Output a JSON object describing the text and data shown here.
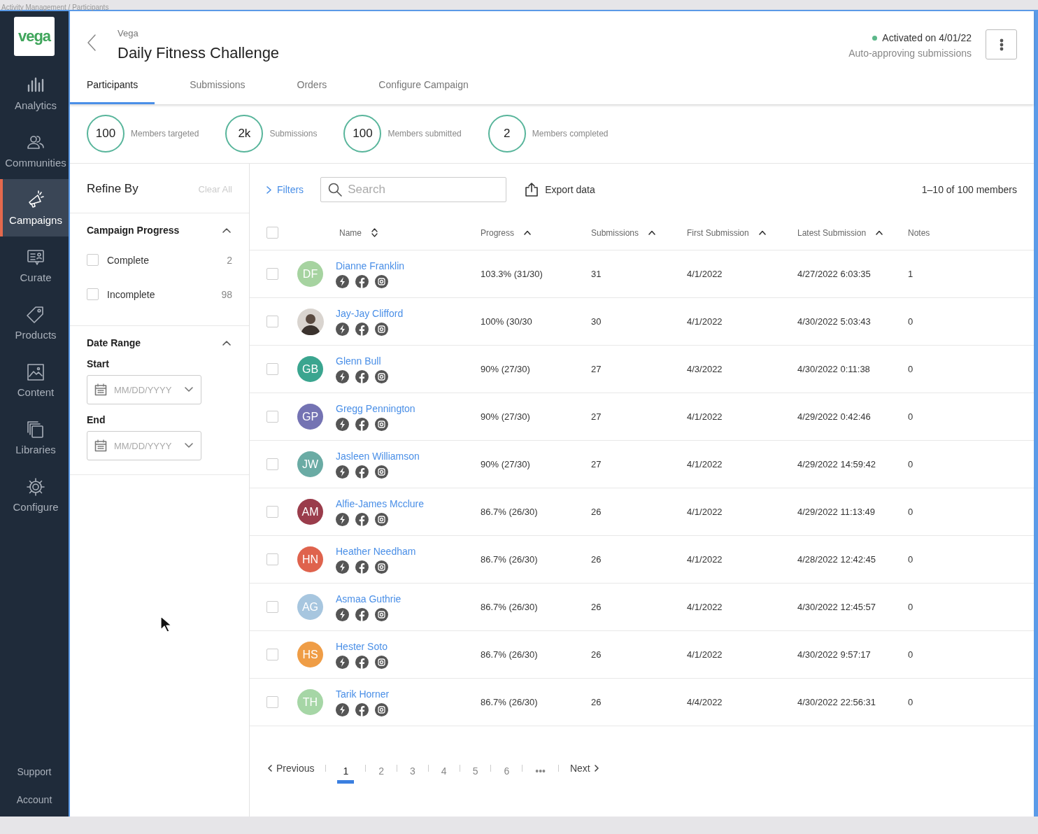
{
  "breadcrumb": "Activity Management / Participants",
  "sidebar": {
    "logo": "vega",
    "items": [
      {
        "label": "Analytics",
        "selected": false
      },
      {
        "label": "Communities",
        "selected": false
      },
      {
        "label": "Campaigns",
        "selected": true
      },
      {
        "label": "Curate",
        "selected": false
      },
      {
        "label": "Products",
        "selected": false
      },
      {
        "label": "Content",
        "selected": false
      },
      {
        "label": "Libraries",
        "selected": false
      },
      {
        "label": "Configure",
        "selected": false
      }
    ],
    "bottom_items": [
      "Support",
      "Account"
    ]
  },
  "header": {
    "org": "Vega",
    "title": "Daily Fitness Challenge",
    "status": "Activated on 4/01/22",
    "note": "Auto-approving submissions"
  },
  "tabs": [
    {
      "label": "Participants",
      "selected": true
    },
    {
      "label": "Submissions",
      "selected": false
    },
    {
      "label": "Orders",
      "selected": false
    },
    {
      "label": "Configure Campaign",
      "selected": false
    }
  ],
  "stats": [
    {
      "value": "100",
      "label": "Members targeted"
    },
    {
      "value": "2k",
      "label": "Submissions"
    },
    {
      "value": "100",
      "label": "Members submitted"
    },
    {
      "value": "2",
      "label": "Members completed"
    }
  ],
  "refine": {
    "title": "Refine By",
    "clear": "Clear All",
    "sections": [
      {
        "kind": "checks",
        "title": "Campaign Progress",
        "expanded": true,
        "options": [
          {
            "label": "Complete",
            "count": "2",
            "checked": false
          },
          {
            "label": "Incomplete",
            "count": "98",
            "checked": false
          }
        ]
      },
      {
        "kind": "dates",
        "title": "Date Range",
        "expanded": true,
        "fields": [
          {
            "label": "Start",
            "placeholder": "MM/DD/YYYY"
          },
          {
            "label": "End",
            "placeholder": "MM/DD/YYYY"
          }
        ]
      }
    ]
  },
  "toolbar": {
    "filters": "Filters",
    "search_placeholder": "Search",
    "export": "Export data",
    "range": "1–10 of 100 members"
  },
  "table": {
    "all_checked": false,
    "columns": [
      "Name",
      "Progress",
      "Submissions",
      "First Submission",
      "Latest Submission",
      "Notes"
    ],
    "rows": [
      {
        "checked": false,
        "kind": "initials",
        "initials": "DF",
        "color": "#a6d3a0",
        "name": "Dianne Franklin",
        "progress": "103.3% (31/30)",
        "submissions": "31",
        "first": "4/1/2022",
        "latest": "4/27/2022 6:03:35",
        "notes": "1"
      },
      {
        "checked": false,
        "kind": "photo",
        "name": "Jay-Jay Clifford",
        "progress": "100% (30/30",
        "submissions": "30",
        "first": "4/1/2022",
        "latest": "4/30/2022 5:03:43",
        "notes": "0"
      },
      {
        "checked": false,
        "kind": "initials",
        "initials": "GB",
        "color": "#3aa58f",
        "name": "Glenn Bull",
        "progress": "90% (27/30)",
        "submissions": "27",
        "first": "4/3/2022",
        "latest": "4/30/2022 0:11:38",
        "notes": "0"
      },
      {
        "checked": false,
        "kind": "initials",
        "initials": "GP",
        "color": "#7473b3",
        "name": "Gregg Pennington",
        "progress": "90% (27/30)",
        "submissions": "27",
        "first": "4/1/2022",
        "latest": "4/29/2022 0:42:46",
        "notes": "0"
      },
      {
        "checked": false,
        "kind": "initials",
        "initials": "JW",
        "color": "#6aaba4",
        "name": "Jasleen Williamson",
        "progress": "90%  (27/30)",
        "submissions": "27",
        "first": "4/1/2022",
        "latest": "4/29/2022 14:59:42",
        "notes": "0"
      },
      {
        "checked": false,
        "kind": "initials",
        "initials": "AM",
        "color": "#9a3c4b",
        "name": "Alfie-James Mcclure",
        "progress": "86.7%  (26/30)",
        "submissions": "26",
        "first": "4/1/2022",
        "latest": "4/29/2022 11:13:49",
        "notes": "0"
      },
      {
        "checked": false,
        "kind": "initials",
        "initials": "HN",
        "color": "#df634d",
        "name": "Heather Needham",
        "progress": "86.7%  (26/30)",
        "submissions": "26",
        "first": "4/1/2022",
        "latest": "4/28/2022 12:42:45",
        "notes": "0"
      },
      {
        "checked": false,
        "kind": "initials",
        "initials": "AG",
        "color": "#a7c6df",
        "name": "Asmaa Guthrie",
        "progress": "86.7%  (26/30)",
        "submissions": "26",
        "first": "4/1/2022",
        "latest": "4/30/2022 12:45:57",
        "notes": "0"
      },
      {
        "checked": false,
        "kind": "initials",
        "initials": "HS",
        "color": "#ef9d46",
        "name": "Hester Soto",
        "progress": "86.7%  (26/30)",
        "submissions": "26",
        "first": "4/1/2022",
        "latest": "4/30/2022 9:57:17",
        "notes": "0"
      },
      {
        "checked": false,
        "kind": "initials",
        "initials": "TH",
        "color": "#a6d6a6",
        "name": "Tarik Horner",
        "progress": "86.7%  (26/30)",
        "submissions": "26",
        "first": "4/4/2022",
        "latest": "4/30/2022 22:56:31",
        "notes": "0"
      }
    ]
  },
  "pagination": {
    "previous": "Previous",
    "pages": [
      {
        "label": "1",
        "selected": true
      },
      {
        "label": "2",
        "selected": false
      },
      {
        "label": "3",
        "selected": false
      },
      {
        "label": "4",
        "selected": false
      },
      {
        "label": "5",
        "selected": false
      },
      {
        "label": "6",
        "selected": false
      }
    ],
    "ellipsis": "•••",
    "next": "Next"
  }
}
